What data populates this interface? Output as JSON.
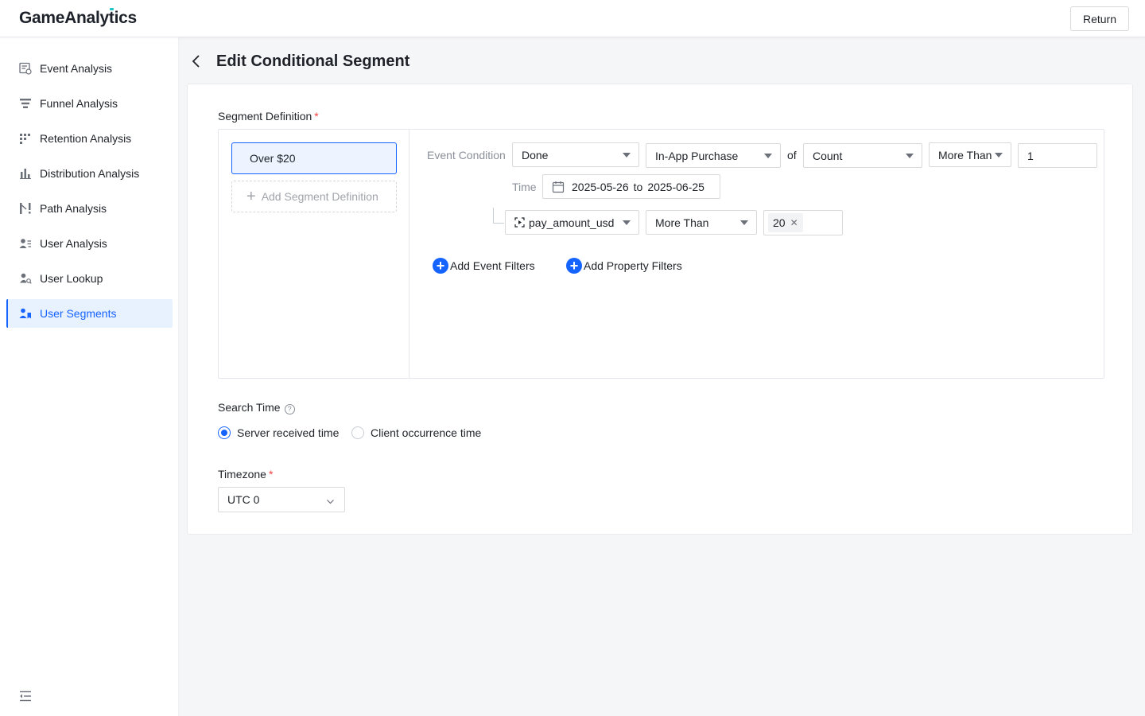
{
  "header": {
    "logo": "GameAnalytics",
    "return_label": "Return"
  },
  "sidebar": {
    "items": [
      {
        "label": "Event Analysis",
        "icon": "event-analysis-icon"
      },
      {
        "label": "Funnel Analysis",
        "icon": "funnel-icon"
      },
      {
        "label": "Retention Analysis",
        "icon": "retention-grid-icon"
      },
      {
        "label": "Distribution Analysis",
        "icon": "bar-chart-icon"
      },
      {
        "label": "Path Analysis",
        "icon": "path-icon"
      },
      {
        "label": "User Analysis",
        "icon": "user-list-icon"
      },
      {
        "label": "User Lookup",
        "icon": "user-search-icon"
      },
      {
        "label": "User Segments",
        "icon": "user-segments-icon",
        "active": true
      }
    ]
  },
  "page": {
    "title": "Edit Conditional Segment"
  },
  "segment": {
    "definition_label": "Segment Definition",
    "items": [
      {
        "name": "Over $20"
      }
    ],
    "add_label": "Add Segment Definition",
    "condition": {
      "label": "Event Condition",
      "status": "Done",
      "event": "In-App Purchase",
      "of_label": "of",
      "metric": "Count",
      "operator": "More Than",
      "value": "1",
      "time_label": "Time",
      "time_start": "2025-05-26",
      "time_to": "to",
      "time_end": "2025-06-25",
      "filter": {
        "property": "pay_amount_usd",
        "operator": "More Than",
        "value_tag": "20"
      }
    },
    "add_event_filters": "Add Event Filters",
    "add_property_filters": "Add Property Filters"
  },
  "search_time": {
    "label": "Search Time",
    "options": [
      {
        "label": "Server received time",
        "selected": true
      },
      {
        "label": "Client occurrence time",
        "selected": false
      }
    ]
  },
  "timezone": {
    "label": "Timezone",
    "value": "UTC 0"
  },
  "colors": {
    "primary": "#1664ff",
    "required": "#f53f3f",
    "active_bg": "#e8f1fe"
  }
}
